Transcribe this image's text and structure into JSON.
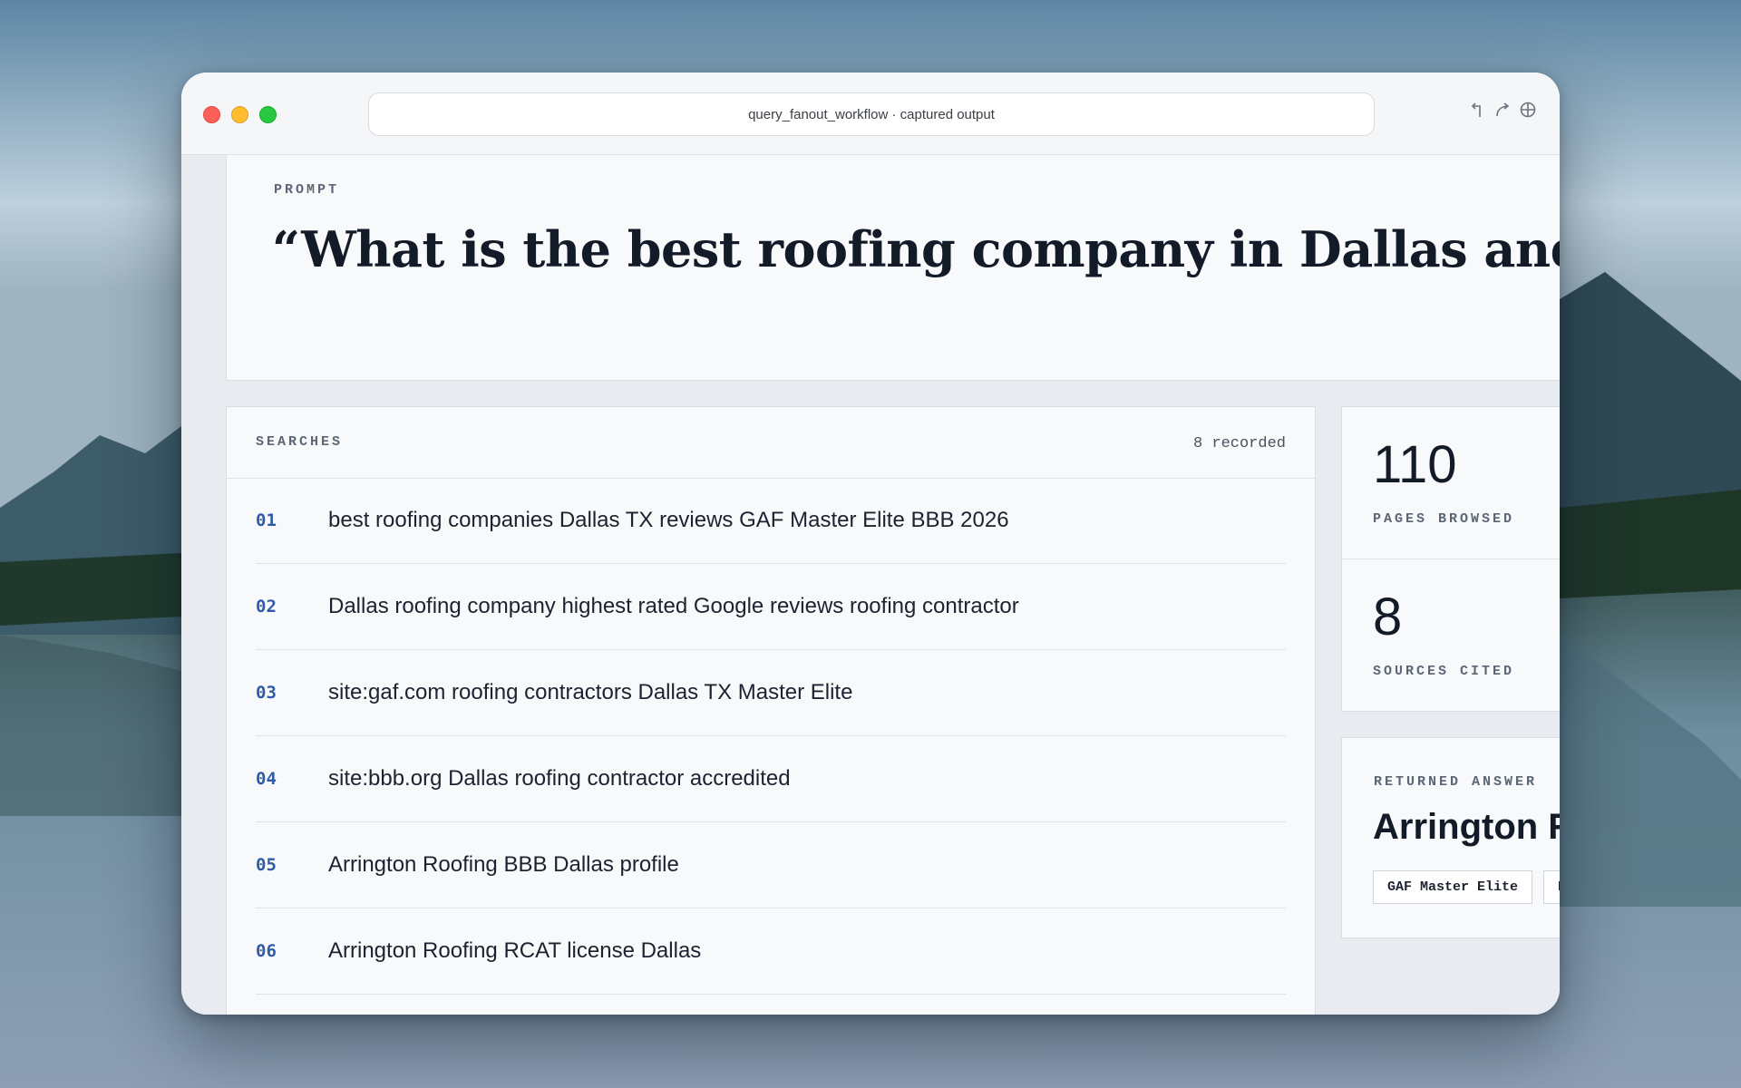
{
  "window": {
    "address_title": "query_fanout_workflow · captured output"
  },
  "prompt": {
    "label": "PROMPT",
    "text": "“What is the best roofing company in Dallas and why?”"
  },
  "searches": {
    "label": "SEARCHES",
    "recorded": "8 recorded",
    "items": [
      {
        "num": "01",
        "query": "best roofing companies Dallas TX reviews GAF Master Elite BBB 2026"
      },
      {
        "num": "02",
        "query": "Dallas roofing company highest rated Google reviews roofing contractor"
      },
      {
        "num": "03",
        "query": "site:gaf.com roofing contractors Dallas TX Master Elite"
      },
      {
        "num": "04",
        "query": "site:bbb.org Dallas roofing contractor accredited"
      },
      {
        "num": "05",
        "query": "Arrington Roofing BBB Dallas profile"
      },
      {
        "num": "06",
        "query": "Arrington Roofing RCAT license Dallas"
      }
    ]
  },
  "stats": {
    "pages_browsed": {
      "value": "110",
      "label": "PAGES BROWSED"
    },
    "sources_cited": {
      "value": "8",
      "label": "SOURCES CITED"
    }
  },
  "answer": {
    "label": "RETURNED ANSWER",
    "name": "Arrington Roofing",
    "tags": [
      "GAF Master Elite",
      "BBB"
    ]
  },
  "colors": {
    "accent_blue": "#2f5ba8",
    "ink": "#141b28"
  }
}
